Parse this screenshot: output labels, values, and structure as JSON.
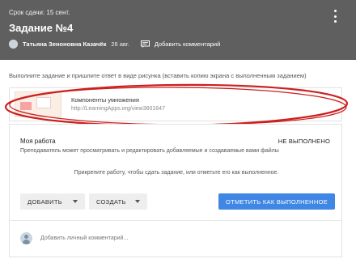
{
  "header": {
    "due": "Срок сдачи: 15 сент.",
    "title": "Задание №4",
    "author": "Татьяна Зеноновна Казачёк",
    "date": "26 авг.",
    "add_comment": "Добавить комментарий"
  },
  "instructions": "Выполните задание и пришлите ответ в виде рисунка (вставить копию экрана с выполненным заданием)",
  "attachment": {
    "title": "Компоненты умножения",
    "url": "http://LearningApps.org/view3601647"
  },
  "work": {
    "title": "Моя работа",
    "status": "НЕ ВЫПОЛНЕНО",
    "description": "Преподаватель может просматривать и редактировать добавляемые и создаваемые вами файлы",
    "hint": "Прикрепите работу, чтобы сдать задание, или отметьте его как выполненное.",
    "add_label": "ДОБАВИТЬ",
    "create_label": "СОЗДАТЬ",
    "done_label": "ОТМЕТИТЬ КАК ВЫПОЛНЕННОЕ",
    "private_comment_placeholder": "Добавить личный комментарий..."
  },
  "colors": {
    "header_bg": "#5f5f5f",
    "primary_button": "#3f86e5",
    "annotation_ellipse": "#cc1f1f"
  }
}
